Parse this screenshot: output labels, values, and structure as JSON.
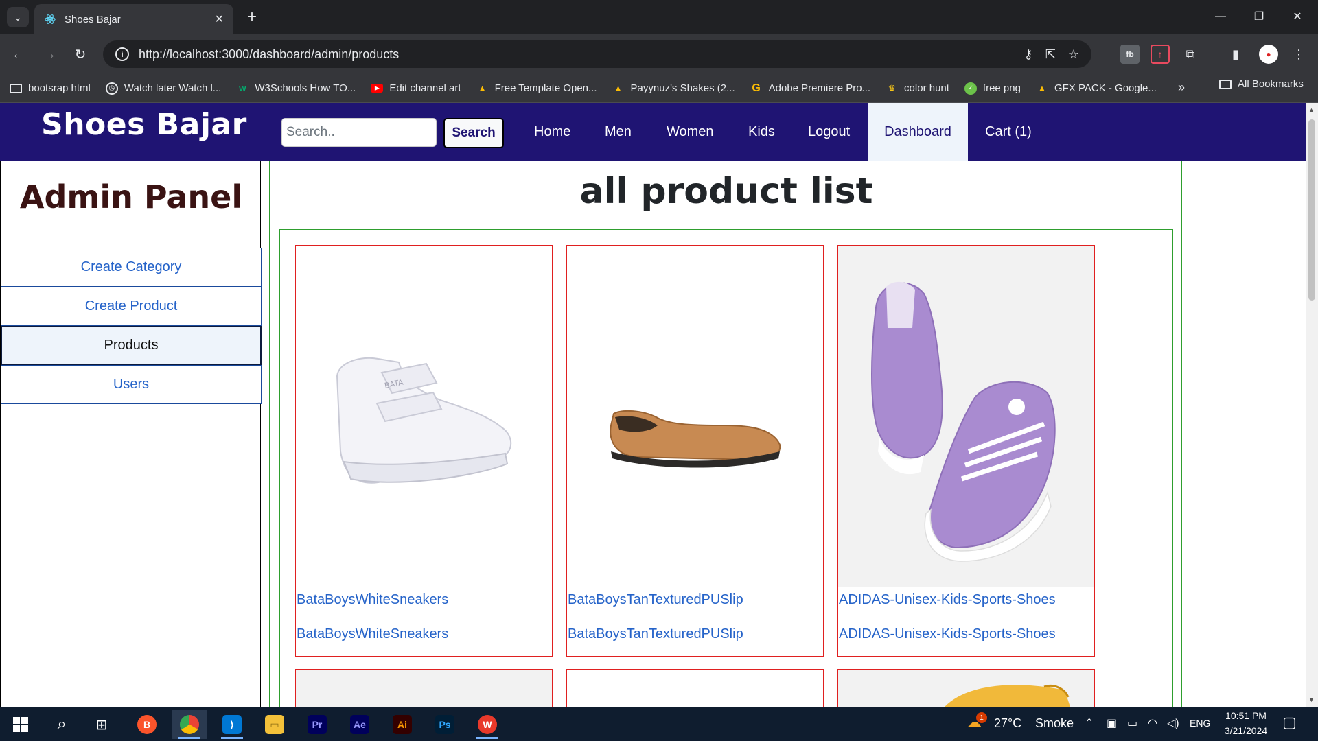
{
  "browser": {
    "tab_title": "Shoes Bajar",
    "url": "http://localhost:3000/dashboard/admin/products",
    "bookmarks": [
      {
        "label": "bootsrap html",
        "icon": "folder-icon"
      },
      {
        "label": "Watch later Watch l...",
        "icon": "clock-icon"
      },
      {
        "label": "W3Schools How TO...",
        "icon": "w3schools-icon"
      },
      {
        "label": "Edit channel art",
        "icon": "youtube-icon"
      },
      {
        "label": "Free Template Open...",
        "icon": "drive-icon"
      },
      {
        "label": "Payynuz's Shakes (2...",
        "icon": "drive-icon"
      },
      {
        "label": "Adobe Premiere Pro...",
        "icon": "google-icon"
      },
      {
        "label": "color hunt",
        "icon": "colorhunt-icon"
      },
      {
        "label": "free png",
        "icon": "png-icon"
      },
      {
        "label": "GFX PACK - Google...",
        "icon": "drive-icon"
      }
    ],
    "all_bookmarks": "All Bookmarks"
  },
  "navbar": {
    "brand": "Shoes Bajar",
    "search_placeholder": "Search..",
    "search_button": "Search",
    "links": {
      "home": "Home",
      "men": "Men",
      "women": "Women",
      "kids": "Kids",
      "logout": "Logout",
      "dashboard": "Dashboard",
      "cart": "Cart (1)"
    }
  },
  "sidebar": {
    "title": "Admin Panel",
    "items": [
      {
        "label": "Create Category",
        "active": false
      },
      {
        "label": "Create Product",
        "active": false
      },
      {
        "label": "Products",
        "active": true
      },
      {
        "label": "Users",
        "active": false
      }
    ]
  },
  "main": {
    "title": "all product list",
    "products": [
      {
        "name": "BataBoysWhiteSneakers",
        "description": "BataBoysWhiteSneakers"
      },
      {
        "name": "BataBoysTanTexturedPUSlip",
        "description": "BataBoysTanTexturedPUSlip"
      },
      {
        "name": "ADIDAS-Unisex-Kids-Sports-Shoes",
        "description": "ADIDAS-Unisex-Kids-Sports-Shoes"
      }
    ]
  },
  "taskbar": {
    "weather_temp": "27°C",
    "weather_desc": "Smoke",
    "weather_badge": "1",
    "language": "ENG",
    "time": "10:51 PM",
    "date": "3/21/2024"
  },
  "colors": {
    "navbar_bg": "#1f1473",
    "card_border": "#e02020",
    "content_border": "#2e9e2e",
    "link_blue": "#2563c9"
  }
}
